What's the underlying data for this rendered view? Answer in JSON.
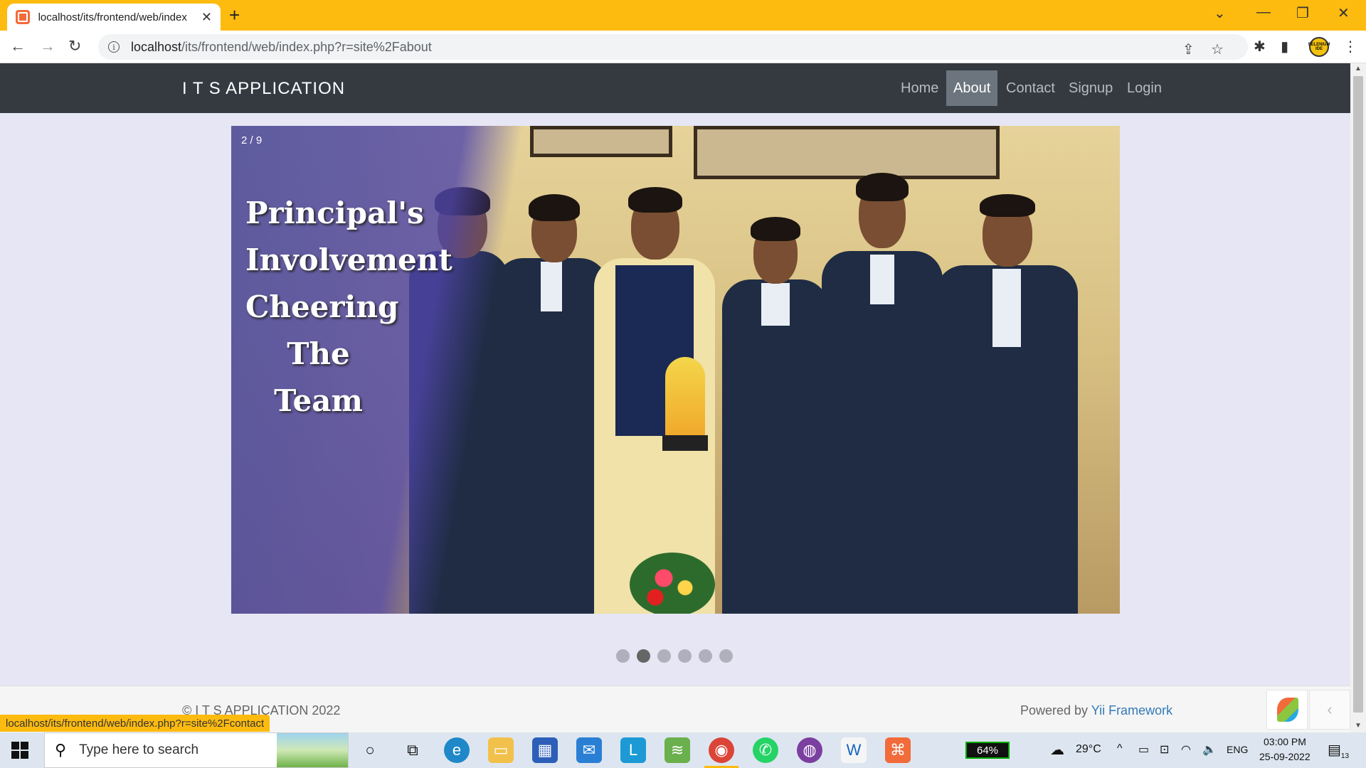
{
  "browser": {
    "tab_title": "localhost/its/frontend/web/index",
    "url_host": "localhost",
    "url_path": "/its/frontend/web/index.php?r=site%2Fabout",
    "status_url": "localhost/its/frontend/web/index.php?r=site%2Fcontact",
    "profile_label": "SELENIUM IDE"
  },
  "navbar": {
    "brand": "I T S APPLICATION",
    "items": [
      {
        "label": "Home",
        "active": false
      },
      {
        "label": "About",
        "active": true
      },
      {
        "label": "Contact",
        "active": false
      },
      {
        "label": "Signup",
        "active": false
      },
      {
        "label": "Login",
        "active": false
      }
    ]
  },
  "carousel": {
    "counter": "2 / 9",
    "caption_lines": [
      "Principal's",
      "Involvement",
      "Cheering",
      "The Team"
    ],
    "dots_total": 6,
    "active_dot": 2
  },
  "footer": {
    "copyright": "© I T S APPLICATION 2022",
    "powered_prefix": "Powered by ",
    "powered_link": "Yii Framework"
  },
  "taskbar": {
    "search_placeholder": "Type here to search",
    "battery": "64%",
    "weather": "29°C",
    "language": "ENG",
    "time": "03:00 PM",
    "date": "25-09-2022",
    "notifications": "13"
  },
  "colors": {
    "browser_accent": "#fdbb10",
    "navbar_bg": "#343a40",
    "page_bg": "#e6e6f5",
    "link": "#337ab7"
  },
  "icons": [
    "favicon-xampp-icon",
    "close-icon",
    "plus-icon",
    "back-icon",
    "forward-icon",
    "reload-icon",
    "info-icon",
    "share-icon",
    "star-icon",
    "extensions-icon",
    "sidepanel-icon",
    "menu-icon"
  ]
}
